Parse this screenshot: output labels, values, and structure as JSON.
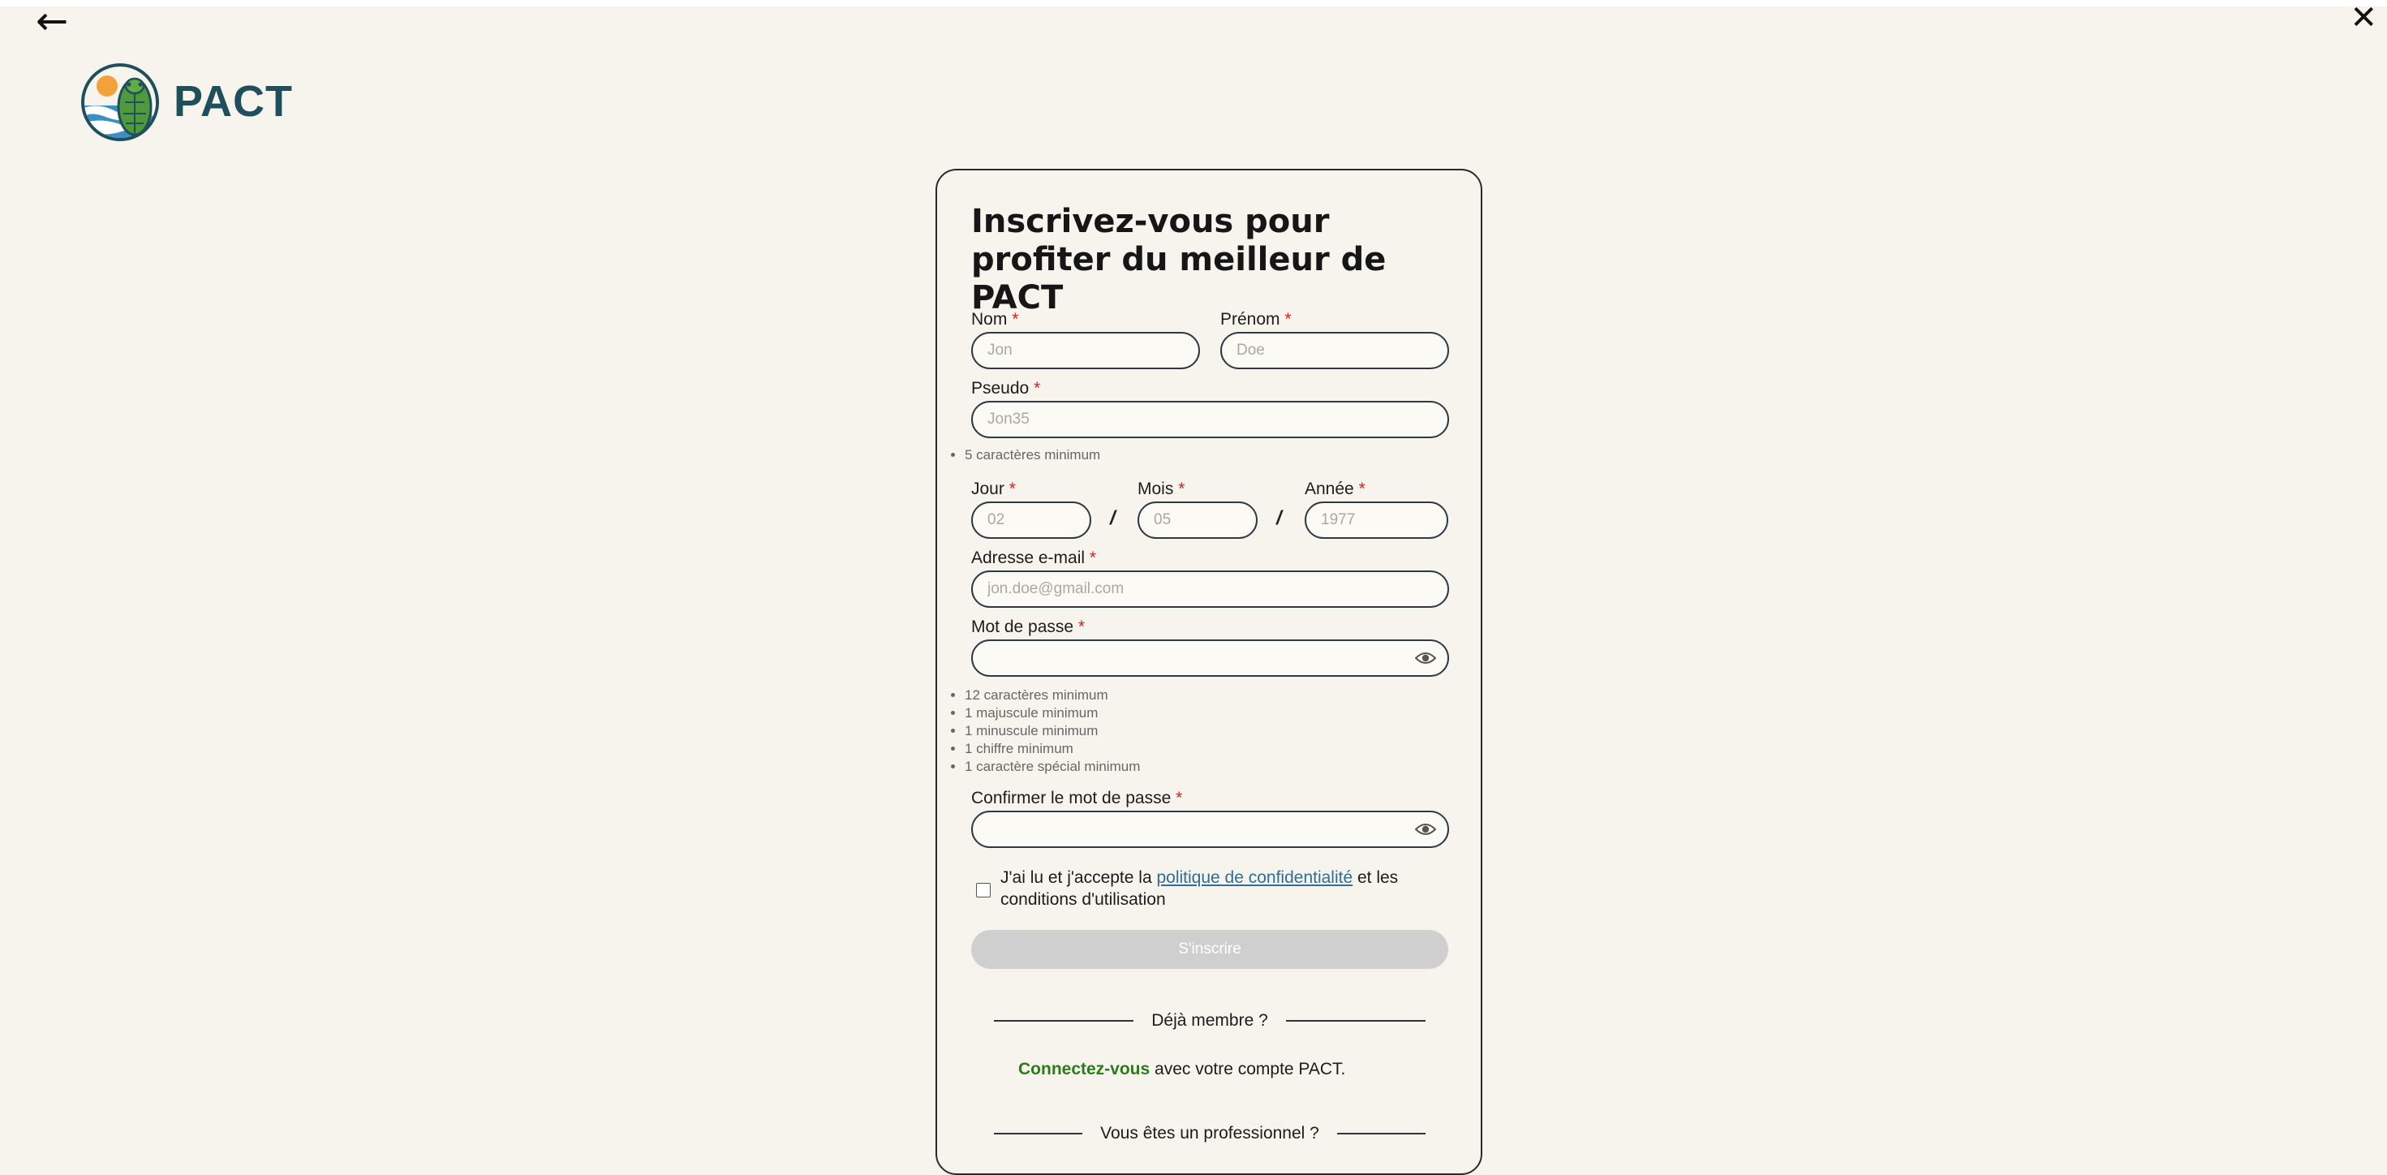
{
  "nav": {
    "back_icon": "arrow-left-icon",
    "close_icon": "close-icon"
  },
  "brand": {
    "name": "PACT",
    "logo": "cicada-logo"
  },
  "form": {
    "title": "Inscrivez-vous pour profiter du meilleur de PACT",
    "required_mark": "*",
    "nom": {
      "label": "Nom",
      "placeholder": "Jon"
    },
    "prenom": {
      "label": "Prénom",
      "placeholder": "Doe"
    },
    "pseudo": {
      "label": "Pseudo",
      "placeholder": "Jon35",
      "hints": [
        "5 caractères minimum"
      ]
    },
    "jour": {
      "label": "Jour",
      "placeholder": "02"
    },
    "mois": {
      "label": "Mois",
      "placeholder": "05"
    },
    "annee": {
      "label": "Année",
      "placeholder": "1977"
    },
    "date_separator": "/",
    "email": {
      "label": "Adresse e-mail",
      "placeholder": "jon.doe@gmail.com"
    },
    "password": {
      "label": "Mot de passe",
      "hints": [
        "12 caractères minimum",
        "1 majuscule minimum",
        "1 minuscule minimum",
        "1 chiffre minimum",
        "1 caractère spécial minimum"
      ]
    },
    "confirm_password": {
      "label": "Confirmer le mot de passe"
    },
    "consent": {
      "before": "J'ai lu et j'accepte la ",
      "link": "politique de confidentialité",
      "after": " et les conditions d'utilisation"
    },
    "submit_label": "S'inscrire",
    "member_separator": "Déjà membre ?",
    "login": {
      "link": "Connectez-vous",
      "rest": " avec votre compte PACT."
    },
    "pro_separator": "Vous êtes un professionnel ?"
  },
  "colors": {
    "background": "#f6f4ec",
    "brand": "#1f4e5c",
    "required": "#d62020",
    "link": "#2f6d9a",
    "login_link": "#2d7a1c",
    "submit_disabled": "#cfcfcf"
  }
}
